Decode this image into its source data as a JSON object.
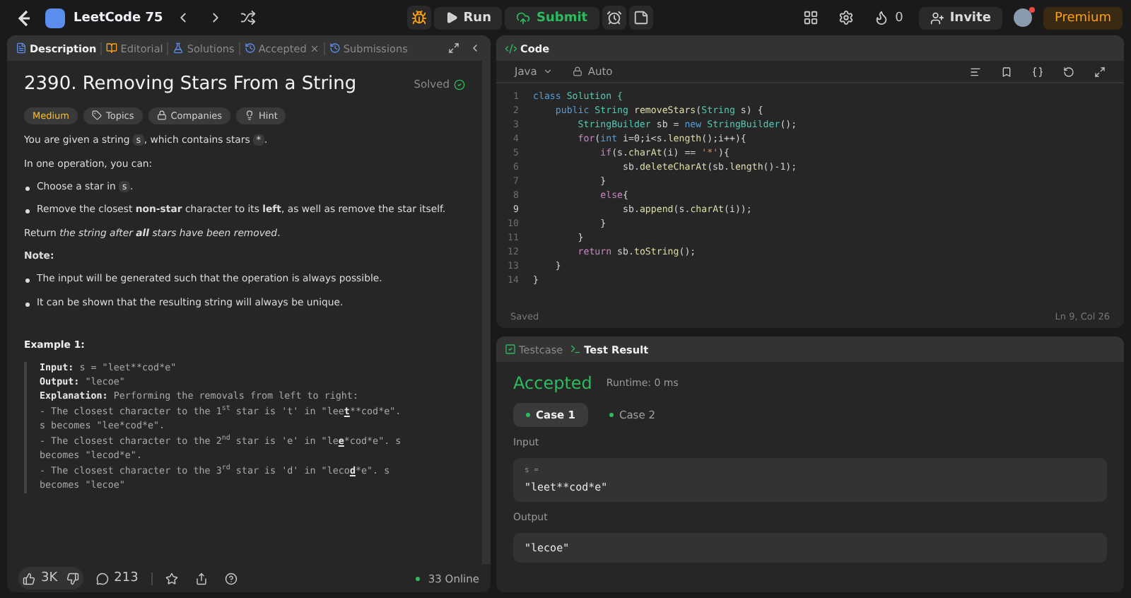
{
  "topbar": {
    "list_title": "LeetCode 75",
    "run_label": "Run",
    "submit_label": "Submit",
    "streak_count": "0",
    "invite_label": "Invite",
    "premium_label": "Premium",
    "notification": true
  },
  "description_panel": {
    "tabs": [
      {
        "label": "Description",
        "selected": true,
        "kind": "description",
        "closable": false
      },
      {
        "label": "Editorial",
        "selected": false,
        "kind": "editorial",
        "closable": false
      },
      {
        "label": "Solutions",
        "selected": false,
        "kind": "solutions",
        "closable": false
      },
      {
        "label": "Accepted",
        "selected": false,
        "kind": "accepted",
        "closable": true
      },
      {
        "label": "Submissions",
        "selected": false,
        "kind": "submissions",
        "closable": false
      }
    ],
    "title": "2390. Removing Stars From a String",
    "status": "Solved",
    "tags": [
      {
        "label": "Medium",
        "kind": "difficulty"
      },
      {
        "label": "Topics",
        "kind": "topics"
      },
      {
        "label": "Companies",
        "kind": "companies"
      },
      {
        "label": "Hint",
        "kind": "hint"
      }
    ],
    "blocks": [
      {
        "kind": "paragraph",
        "segments": [
          {
            "t": "You are given a string ",
            "kind": "text"
          },
          {
            "t": "s",
            "kind": "code"
          },
          {
            "t": ", which contains stars ",
            "kind": "text"
          },
          {
            "t": "*",
            "kind": "code"
          },
          {
            "t": ".",
            "kind": "text"
          }
        ]
      },
      {
        "kind": "paragraph",
        "segments": [
          {
            "t": "In one operation, you can:",
            "kind": "text"
          }
        ]
      },
      {
        "kind": "bullet",
        "segments": [
          {
            "t": "Choose a star in ",
            "kind": "text"
          },
          {
            "t": "s",
            "kind": "code"
          },
          {
            "t": ".",
            "kind": "text"
          }
        ]
      },
      {
        "kind": "bullet",
        "segments": [
          {
            "t": "Remove the closest ",
            "kind": "text"
          },
          {
            "t": "non-star",
            "kind": "bold"
          },
          {
            "t": " character to its ",
            "kind": "text"
          },
          {
            "t": "left",
            "kind": "bold"
          },
          {
            "t": ", as well as remove the star itself.",
            "kind": "text"
          }
        ]
      },
      {
        "kind": "paragraph",
        "segments": [
          {
            "t": "Return ",
            "kind": "text"
          },
          {
            "t": "the string after ",
            "kind": "italic"
          },
          {
            "t": "all",
            "kind": "bolditalic"
          },
          {
            "t": " stars have been removed",
            "kind": "italic"
          },
          {
            "t": ".",
            "kind": "text"
          }
        ]
      },
      {
        "kind": "heading",
        "segments": [
          {
            "t": "Note:",
            "kind": "bold"
          }
        ]
      },
      {
        "kind": "bullet",
        "segments": [
          {
            "t": "The input will be generated such that the operation is always possible.",
            "kind": "text"
          }
        ]
      },
      {
        "kind": "bullet",
        "segments": [
          {
            "t": "It can be shown that the resulting string will always be unique.",
            "kind": "text"
          }
        ]
      }
    ],
    "example_title": "Example 1:",
    "example_lines": [
      [
        {
          "t": "Input:",
          "kind": "label"
        },
        {
          "t": " s = \"leet**cod*e\"",
          "kind": "text"
        }
      ],
      [
        {
          "t": "Output:",
          "kind": "label"
        },
        {
          "t": " \"lecoe\"",
          "kind": "text"
        }
      ],
      [
        {
          "t": "Explanation:",
          "kind": "label"
        },
        {
          "t": " Performing the removals from left to right:",
          "kind": "text"
        }
      ],
      [
        {
          "t": "- The closest character to the 1",
          "kind": "text"
        },
        {
          "t": "st",
          "kind": "sup"
        },
        {
          "t": " star is 't' in \"lee",
          "kind": "text"
        },
        {
          "t": "t",
          "kind": "mark"
        },
        {
          "t": "**cod*e\".",
          "kind": "text"
        }
      ],
      [
        {
          "t": "s becomes \"lee*cod*e\".",
          "kind": "text"
        }
      ],
      [
        {
          "t": "- The closest character to the 2",
          "kind": "text"
        },
        {
          "t": "nd",
          "kind": "sup"
        },
        {
          "t": " star is 'e' in \"le",
          "kind": "text"
        },
        {
          "t": "e",
          "kind": "mark"
        },
        {
          "t": "*cod*e\". s",
          "kind": "text"
        }
      ],
      [
        {
          "t": "becomes \"lecod*e\".",
          "kind": "text"
        }
      ],
      [
        {
          "t": "- The closest character to the 3",
          "kind": "text"
        },
        {
          "t": "rd",
          "kind": "sup"
        },
        {
          "t": " star is 'd' in \"leco",
          "kind": "text"
        },
        {
          "t": "d",
          "kind": "mark"
        },
        {
          "t": "*e\". s",
          "kind": "text"
        }
      ],
      [
        {
          "t": "becomes \"lecoe\"",
          "kind": "text"
        }
      ]
    ],
    "footer": {
      "likes": "3K",
      "comments": "213",
      "online": "33 Online"
    }
  },
  "code_panel": {
    "title": "Code",
    "language": "Java",
    "mode": "Auto",
    "status": "Saved",
    "cursor": "Ln 9, Col 26",
    "lines": [
      {
        "number": "1",
        "current": false,
        "tokens": [
          {
            "t": "class",
            "kind": "kw"
          },
          {
            "t": " Solution {",
            "kind": "type"
          }
        ]
      },
      {
        "number": "2",
        "current": false,
        "tokens": [
          {
            "t": "    public",
            "kind": "kw"
          },
          {
            "t": " String",
            "kind": "type"
          },
          {
            "t": " removeStars",
            "kind": "fn"
          },
          {
            "t": "(",
            "kind": "plain"
          },
          {
            "t": "String",
            "kind": "type"
          },
          {
            "t": " s) {",
            "kind": "plain"
          }
        ]
      },
      {
        "number": "3",
        "current": false,
        "tokens": [
          {
            "t": "        StringBuilder",
            "kind": "type"
          },
          {
            "t": " sb = ",
            "kind": "plain"
          },
          {
            "t": "new",
            "kind": "kw"
          },
          {
            "t": " StringBuilder",
            "kind": "type"
          },
          {
            "t": "();",
            "kind": "plain"
          }
        ]
      },
      {
        "number": "4",
        "current": false,
        "tokens": [
          {
            "t": "        for",
            "kind": "ctl"
          },
          {
            "t": "(",
            "kind": "plain"
          },
          {
            "t": "int",
            "kind": "kw"
          },
          {
            "t": " i=0;i<s.",
            "kind": "plain"
          },
          {
            "t": "length",
            "kind": "fn"
          },
          {
            "t": "();i++){",
            "kind": "plain"
          }
        ]
      },
      {
        "number": "5",
        "current": false,
        "tokens": [
          {
            "t": "            if",
            "kind": "ctl"
          },
          {
            "t": "(s.",
            "kind": "plain"
          },
          {
            "t": "charAt",
            "kind": "fn"
          },
          {
            "t": "(i) == ",
            "kind": "plain"
          },
          {
            "t": "'*'",
            "kind": "str"
          },
          {
            "t": "){",
            "kind": "plain"
          }
        ]
      },
      {
        "number": "6",
        "current": false,
        "tokens": [
          {
            "t": "                sb.",
            "kind": "plain"
          },
          {
            "t": "deleteCharAt",
            "kind": "fn"
          },
          {
            "t": "(sb.",
            "kind": "plain"
          },
          {
            "t": "length",
            "kind": "fn"
          },
          {
            "t": "()-1);",
            "kind": "plain"
          }
        ]
      },
      {
        "number": "7",
        "current": false,
        "tokens": [
          {
            "t": "            }",
            "kind": "plain"
          }
        ]
      },
      {
        "number": "8",
        "current": false,
        "tokens": [
          {
            "t": "            else",
            "kind": "ctl"
          },
          {
            "t": "{",
            "kind": "plain"
          }
        ]
      },
      {
        "number": "9",
        "current": true,
        "tokens": [
          {
            "t": "                sb.",
            "kind": "plain"
          },
          {
            "t": "append",
            "kind": "fn"
          },
          {
            "t": "(s.",
            "kind": "plain"
          },
          {
            "t": "charAt",
            "kind": "fn"
          },
          {
            "t": "(i));",
            "kind": "plain"
          }
        ]
      },
      {
        "number": "10",
        "current": false,
        "tokens": [
          {
            "t": "            }",
            "kind": "plain"
          }
        ]
      },
      {
        "number": "11",
        "current": false,
        "tokens": [
          {
            "t": "        }",
            "kind": "plain"
          }
        ]
      },
      {
        "number": "12",
        "current": false,
        "tokens": [
          {
            "t": "        return",
            "kind": "ctl"
          },
          {
            "t": " sb.",
            "kind": "plain"
          },
          {
            "t": "toString",
            "kind": "fn"
          },
          {
            "t": "();",
            "kind": "plain"
          }
        ]
      },
      {
        "number": "13",
        "current": false,
        "tokens": [
          {
            "t": "    }",
            "kind": "plain"
          }
        ]
      },
      {
        "number": "14",
        "current": false,
        "tokens": [
          {
            "t": "}",
            "kind": "plain"
          }
        ]
      }
    ]
  },
  "result_panel": {
    "tabs": [
      {
        "label": "Testcase",
        "selected": false
      },
      {
        "label": "Test Result",
        "selected": true
      }
    ],
    "verdict": "Accepted",
    "runtime": "Runtime: 0 ms",
    "cases": [
      {
        "label": "Case 1",
        "selected": true
      },
      {
        "label": "Case 2",
        "selected": false
      }
    ],
    "input_label": "Input",
    "input_name": "s =",
    "input_value": "\"leet**cod*e\"",
    "output_label": "Output",
    "output_value": "\"lecoe\""
  }
}
